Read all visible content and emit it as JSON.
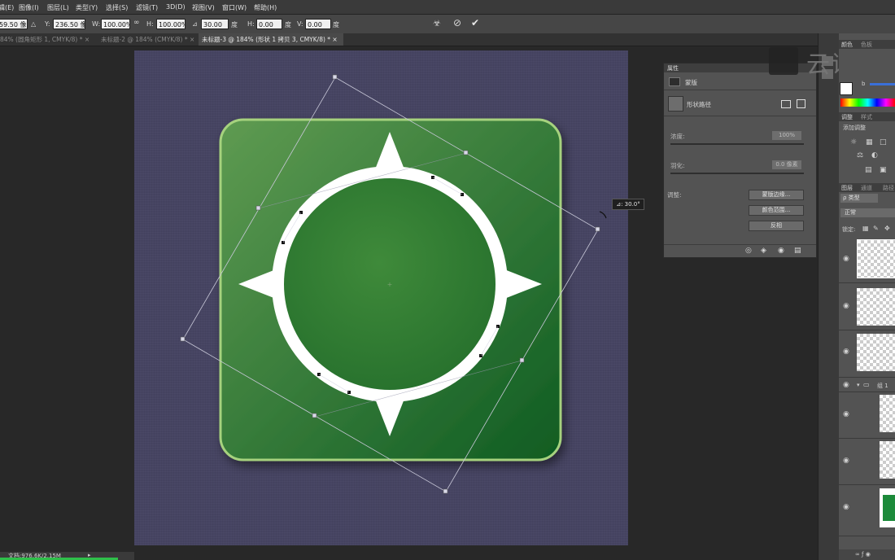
{
  "menubar": {
    "items": [
      "编辑(E)",
      "图像(I)",
      "图层(L)",
      "类型(Y)",
      "选择(S)",
      "滤镜(T)",
      "3D(D)",
      "视图(V)",
      "窗口(W)",
      "帮助(H)"
    ]
  },
  "options": {
    "x_value": "59.50 像素",
    "y_label": "Y:",
    "y_value": "236.50 像素",
    "w_label": "W:",
    "w_value": "100.00%",
    "h_label": "H:",
    "h_value": "100.00%",
    "angle_value": "30.00",
    "angle_unit": "度",
    "hskew_label": "H:",
    "hskew_value": "0.00",
    "hskew_unit": "度",
    "vskew_label": "V:",
    "vskew_value": "0.00",
    "vskew_unit": "度"
  },
  "tabs": [
    {
      "label": "84% (圆角矩形 1, CMYK/8) *",
      "active": false
    },
    {
      "label": "未标题-2 @ 184% (CMYK/8) *",
      "active": false
    },
    {
      "label": "未标题-3 @ 184% (形状 1 拷贝 3, CMYK/8) *",
      "active": true
    }
  ],
  "canvas": {
    "background_color": "#464462",
    "icon_green_light": "#5f9b52",
    "icon_green_dark": "#0f5c22",
    "rotation_readout": "⊿: 30.0°"
  },
  "properties": {
    "title": "属性",
    "mask_label": "蒙版",
    "shape_path_label": "形状路径",
    "density_label": "浓度:",
    "density_value": "100%",
    "feather_label": "羽化:",
    "feather_value": "0.0 像素",
    "adjust_label": "调整:",
    "btn_mask_edge": "蒙版边缘...",
    "btn_color_range": "颜色范围...",
    "btn_invert": "反相"
  },
  "rightpanel": {
    "color_tab": "颜色",
    "swatches_tab": "色板",
    "b_label": "b",
    "adjust_tab": "调整",
    "styles_tab": "样式",
    "add_adjust": "添加调整",
    "layers_tab": "图层",
    "channels_tab": "通道",
    "paths_tab": "路径",
    "kind_filter": "ρ 类型",
    "blend_mode": "正常",
    "lock_label": "锁定:",
    "group_label": "组 1"
  },
  "statusbar": {
    "doc_label": "文档:976.6K/2.15M"
  },
  "watermark": {
    "text": "云课堂"
  }
}
